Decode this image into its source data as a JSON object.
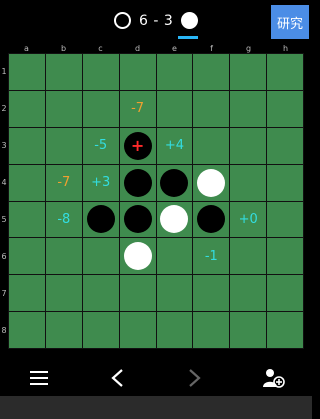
{
  "header": {
    "score_text": "6 - 3",
    "research_label": "研究",
    "turn_color": "#29b6f6"
  },
  "board": {
    "columns": [
      "a",
      "b",
      "c",
      "d",
      "e",
      "f",
      "g",
      "h"
    ],
    "rows": [
      "1",
      "2",
      "3",
      "4",
      "5",
      "6",
      "7",
      "8"
    ],
    "discs": [
      {
        "cell": "d3",
        "color": "black",
        "last_move": true
      },
      {
        "cell": "d4",
        "color": "black"
      },
      {
        "cell": "e4",
        "color": "black"
      },
      {
        "cell": "f4",
        "color": "white"
      },
      {
        "cell": "c5",
        "color": "black"
      },
      {
        "cell": "d5",
        "color": "black"
      },
      {
        "cell": "e5",
        "color": "white"
      },
      {
        "cell": "f5",
        "color": "black"
      },
      {
        "cell": "d6",
        "color": "white"
      }
    ],
    "hints": [
      {
        "cell": "d2",
        "text": "-7",
        "color": "#f0a030"
      },
      {
        "cell": "c3",
        "text": "-5",
        "color": "#33dde0"
      },
      {
        "cell": "e3",
        "text": "+4",
        "color": "#33dde0"
      },
      {
        "cell": "b4",
        "text": "-7",
        "color": "#f0a030"
      },
      {
        "cell": "c4",
        "text": "+3",
        "color": "#33dde0"
      },
      {
        "cell": "b5",
        "text": "-8",
        "color": "#33dde0"
      },
      {
        "cell": "g5",
        "text": "+0",
        "color": "#33dde0"
      },
      {
        "cell": "f6",
        "text": "-1",
        "color": "#33dde0"
      }
    ],
    "last_move_mark": "+",
    "cell_color": "#3f8b4e"
  },
  "toolbar": {
    "menu_icon": "☰",
    "back_icon": "〈",
    "forward_icon": "〉",
    "player_settings_icon": "user-add-icon"
  }
}
